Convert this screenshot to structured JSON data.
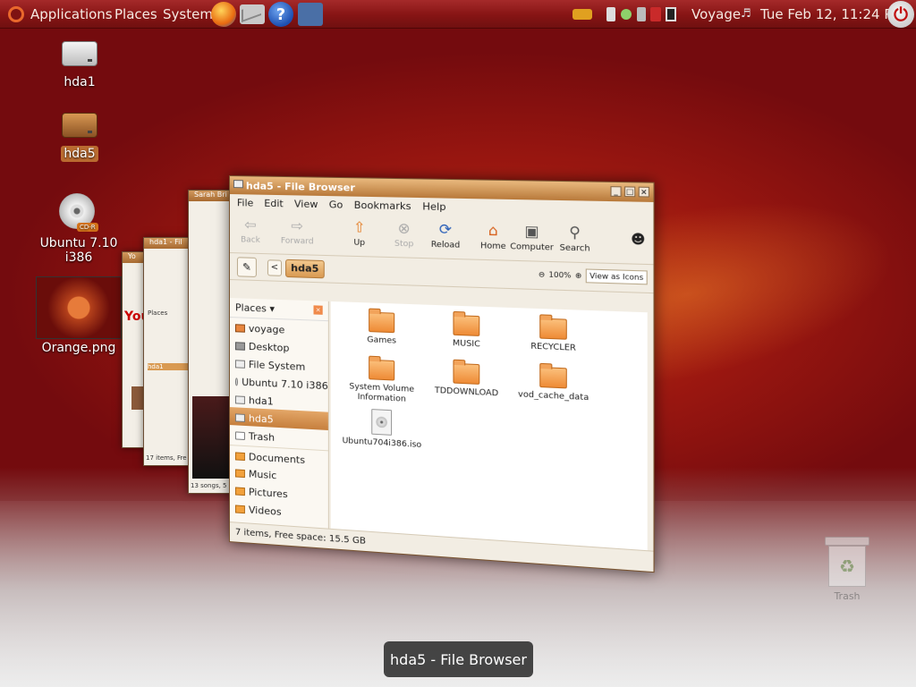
{
  "panel": {
    "menus": [
      "Applications",
      "Places",
      "System"
    ],
    "user": "Voyage",
    "clock": "Tue Feb 12, 11:24 PM"
  },
  "desktop_icons": [
    {
      "label": "hda1"
    },
    {
      "label": "hda5"
    },
    {
      "label": "Ubuntu 7.10 i386",
      "badge": "CD-R"
    },
    {
      "label": "Orange.png"
    }
  ],
  "background_windows": {
    "w1": {
      "title": "Yo"
    },
    "w2": {
      "title": "hda1 - Fil",
      "status": "17 items, Fre"
    },
    "w3": {
      "title": "Sarah Bri",
      "status": "13 songs, 5"
    }
  },
  "window": {
    "title": "hda5 - File Browser",
    "menus": [
      "File",
      "Edit",
      "View",
      "Go",
      "Bookmarks",
      "Help"
    ],
    "toolbar": {
      "back": "Back",
      "forward": "Forward",
      "up": "Up",
      "stop": "Stop",
      "reload": "Reload",
      "home": "Home",
      "computer": "Computer",
      "search": "Search"
    },
    "location": "hda5",
    "zoom": "100%",
    "view_mode": "View as Icons",
    "sidebar_header": "Places",
    "places": [
      "voyage",
      "Desktop",
      "File System",
      "Ubuntu 7.10 i386",
      "hda1",
      "hda5",
      "Trash"
    ],
    "bookmarks": [
      "Documents",
      "Music",
      "Pictures",
      "Videos"
    ],
    "files": [
      "Games",
      "MUSIC",
      "RECYCLER",
      "System Volume Information",
      "TDDOWNLOAD",
      "vod_cache_data",
      "Ubuntu704i386.iso"
    ],
    "status": "7 items, Free space: 15.5 GB"
  },
  "switcher_label": "hda5 - File Browser",
  "trash_label": "Trash",
  "colors": {
    "panel": "#861414",
    "selection": "#c67f3d",
    "desktop": "#9b1710"
  }
}
